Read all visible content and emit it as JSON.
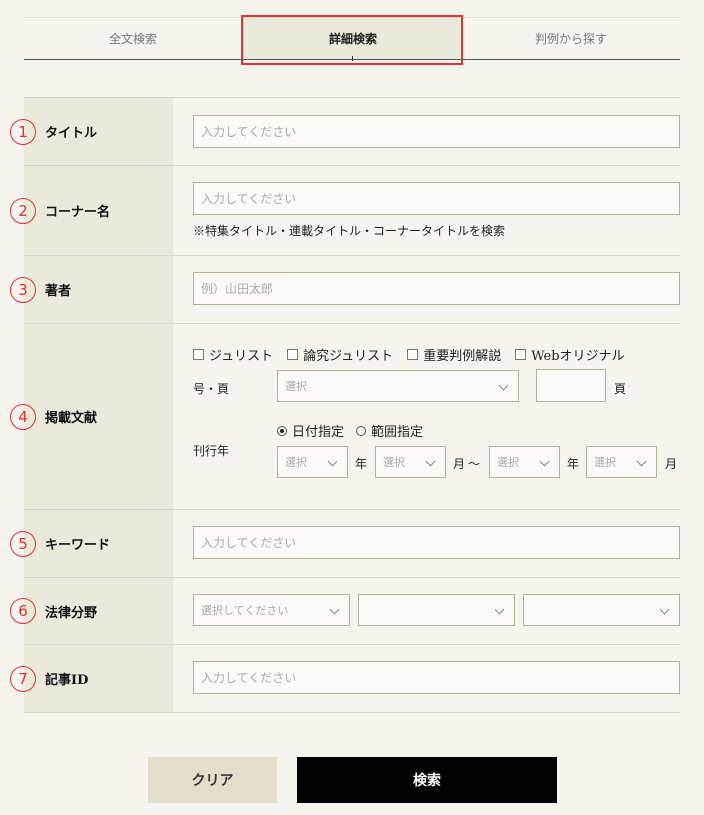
{
  "tabs": {
    "fulltext": "全文検索",
    "detail": "詳細検索",
    "caselaw": "判例から探す"
  },
  "fields": {
    "title": {
      "num": "1",
      "label": "タイトル",
      "placeholder": "入力してください"
    },
    "corner": {
      "num": "2",
      "label": "コーナー名",
      "placeholder": "入力してください",
      "note": "※特集タイトル・連載タイトル・コーナータイトルを検索"
    },
    "author": {
      "num": "3",
      "label": "著者",
      "placeholder": "例）山田太郎"
    },
    "publication": {
      "num": "4",
      "label": "掲載文献",
      "checkboxes": [
        "ジュリスト",
        "論究ジュリスト",
        "重要判例解説",
        "Webオリジナル"
      ],
      "issue_label": "号・頁",
      "issue_select": "選択",
      "page_unit": "頁",
      "year_label": "刊行年",
      "radio_date": "日付指定",
      "radio_range": "範囲指定",
      "select": "選択",
      "year_unit": "年",
      "month_unit": "月",
      "tilde": "〜"
    },
    "keyword": {
      "num": "5",
      "label": "キーワード",
      "placeholder": "入力してください"
    },
    "law": {
      "num": "6",
      "label": "法律分野",
      "select1": "選択してください"
    },
    "article_id": {
      "num": "7",
      "label": "記事ID",
      "placeholder": "入力してください"
    }
  },
  "buttons": {
    "clear": "クリア",
    "search": "検索"
  },
  "colors": {
    "accent_red": "#e0332e",
    "label_bg": "#ebe8dc",
    "page_bg": "#f6f4ef"
  }
}
